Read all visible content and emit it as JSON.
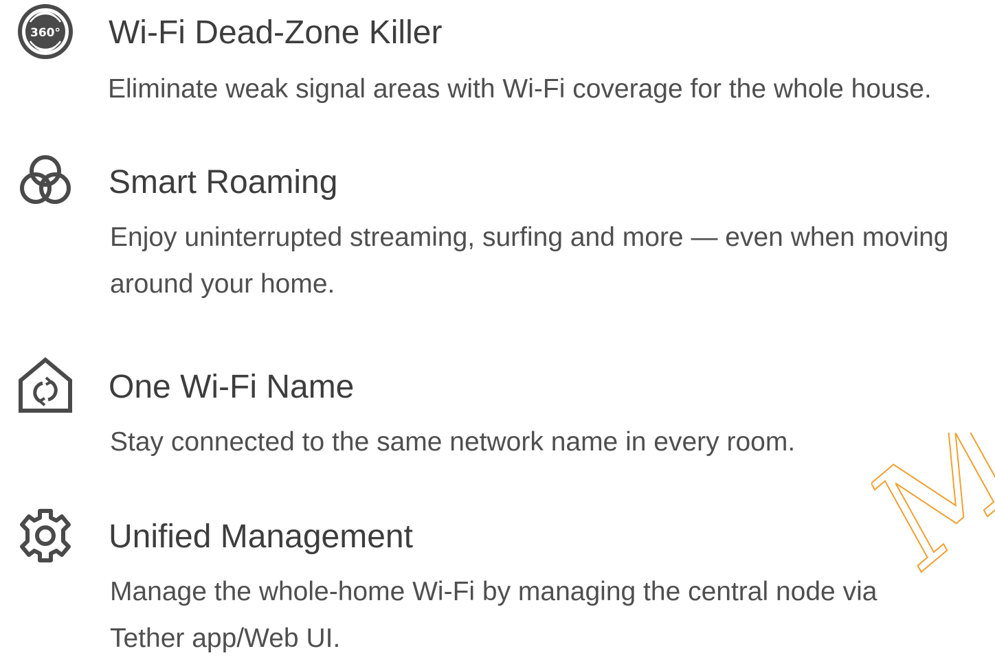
{
  "features": [
    {
      "icon": "360-signal-icon",
      "icon_text": "360°",
      "title": "Wi-Fi Dead-Zone Killer",
      "description": "Eliminate weak signal areas with Wi-Fi coverage for the whole house."
    },
    {
      "icon": "roaming-circles-icon",
      "title": "Smart Roaming",
      "description": "Enjoy uninterrupted streaming, surfing and more — even when moving around your home."
    },
    {
      "icon": "home-sync-icon",
      "title": "One Wi-Fi Name",
      "description": "Stay connected to the same network name in every room."
    },
    {
      "icon": "gear-icon",
      "title": "Unified Management",
      "description": "Manage the whole-home Wi-Fi by managing the central node via Tether app/Web UI."
    }
  ],
  "watermark": {
    "text": "Ma"
  },
  "colors": {
    "icon": "#4a4a4a",
    "title": "#3d3d3d",
    "text": "#4f4f4f",
    "watermark": "#f0a030"
  }
}
